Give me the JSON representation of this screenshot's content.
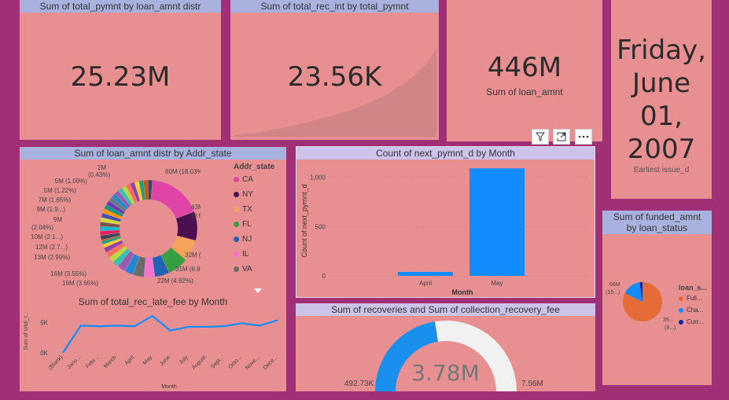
{
  "card1": {
    "title": "Sum of total_pymnt by loan_amnt distr",
    "value": "25.23M"
  },
  "card2": {
    "title": "Sum of total_rec_int by total_pymnt",
    "value": "23.56K"
  },
  "card3": {
    "value": "446M",
    "label": "Sum of loan_amnt"
  },
  "card4": {
    "value_lines": [
      "Friday,",
      "June",
      "01,",
      "2007"
    ],
    "label": "Earliest issue_d"
  },
  "toolbar": {
    "icons": [
      "filter-icon",
      "focus-mode-icon",
      "more-options-icon"
    ]
  },
  "donut": {
    "title": "Sum of loan_amnt distr by Addr_state",
    "legend_title": "Addr_state",
    "legend": [
      {
        "label": "CA",
        "color": "#e044a7"
      },
      {
        "label": "NY",
        "color": "#4a1050"
      },
      {
        "label": "TX",
        "color": "#f5a25d"
      },
      {
        "label": "FL",
        "color": "#35a041"
      },
      {
        "label": "NJ",
        "color": "#1f63b5"
      },
      {
        "label": "IL",
        "color": "#f472d0"
      },
      {
        "label": "VA",
        "color": "#6b6b6b"
      }
    ],
    "labels": [
      "2M",
      "(0.43%)",
      "5M (1.09%)",
      "5M (1.22%)",
      "7M (1.65%)",
      "9M (1.9...)",
      "9M",
      "(2.04%)",
      "10M (2.1...)",
      "12M (2.7...)",
      "13M (2.99%)",
      "16M (3.55%)",
      "16M (3.65%)",
      "22M (4.92%)",
      "31M (6.93%)",
      "32M (7.16%)",
      "43M",
      "(9.64%)",
      "80M (18.03%)"
    ]
  },
  "chart_data": [
    {
      "type": "pie",
      "title": "Sum of loan_amnt distr by Addr_state",
      "legend_title": "Addr_state",
      "categories": [
        "CA",
        "NY",
        "TX",
        "FL",
        "NJ",
        "IL",
        "VA"
      ],
      "values": [
        80,
        43,
        32,
        31,
        22,
        16,
        16,
        13,
        12,
        10,
        9,
        9,
        7,
        5,
        5,
        2
      ],
      "percent": [
        18.03,
        9.64,
        7.16,
        6.93,
        4.92,
        3.65,
        3.55,
        2.99,
        2.7,
        2.1,
        2.04,
        1.9,
        1.65,
        1.22,
        1.09,
        0.43
      ],
      "unit": "M"
    },
    {
      "type": "bar",
      "title": "Count of next_pymnt_d by Month",
      "categories": [
        "April",
        "May"
      ],
      "values": [
        40,
        1090
      ],
      "xlabel": "Month",
      "ylabel": "Count of next_pymnt_d",
      "ylim": [
        0,
        1100
      ],
      "yticks": [
        "0",
        "500",
        "1,000"
      ],
      "color": "#118dff"
    },
    {
      "type": "line",
      "title": "Sum of total_rec_late_fee by Month",
      "categories": [
        "(Blank)",
        "Janu...",
        "Febr...",
        "March",
        "April",
        "May",
        "June",
        "July",
        "August",
        "Sept...",
        "Octo...",
        "Nove...",
        "Dece..."
      ],
      "values": [
        0,
        4.5,
        4.4,
        4.5,
        4.4,
        6.1,
        3.7,
        4.3,
        4.3,
        4.4,
        4.9,
        4.5,
        5.4
      ],
      "xlabel": "Month",
      "ylabel": "Sum of total_r...",
      "yticks": [
        "0K",
        "5K"
      ],
      "ylim": [
        0,
        6.5
      ],
      "color": "#118dff"
    },
    {
      "type": "pie",
      "title": "Sum of funded_amnt by loan_status",
      "legend_title": "loan_s...",
      "categories": [
        "Full...",
        "Cha...",
        "Curr..."
      ],
      "values": [
        355,
        66,
        10
      ],
      "colors": [
        "#e66c37",
        "#118dff",
        "#12239e"
      ],
      "labels": [
        "66M",
        "(15...)",
        "35...",
        "(8...)"
      ]
    }
  ],
  "gauge": {
    "title": "Sum of recoveries and Sum of collection_recovery_fee",
    "value": "3.78M",
    "min": "492.73K",
    "max": "7.56M",
    "fraction": 0.45
  },
  "loan_status": {
    "title": "Sum of funded_amnt by loan_status",
    "legend_title": "loan_s...",
    "legend": [
      {
        "label": "Full...",
        "color": "#e66c37"
      },
      {
        "label": "Cha...",
        "color": "#118dff"
      },
      {
        "label": "Curr...",
        "color": "#12239e"
      }
    ],
    "labels": [
      "66M",
      "(15...)",
      "35...",
      "(8...)"
    ]
  }
}
